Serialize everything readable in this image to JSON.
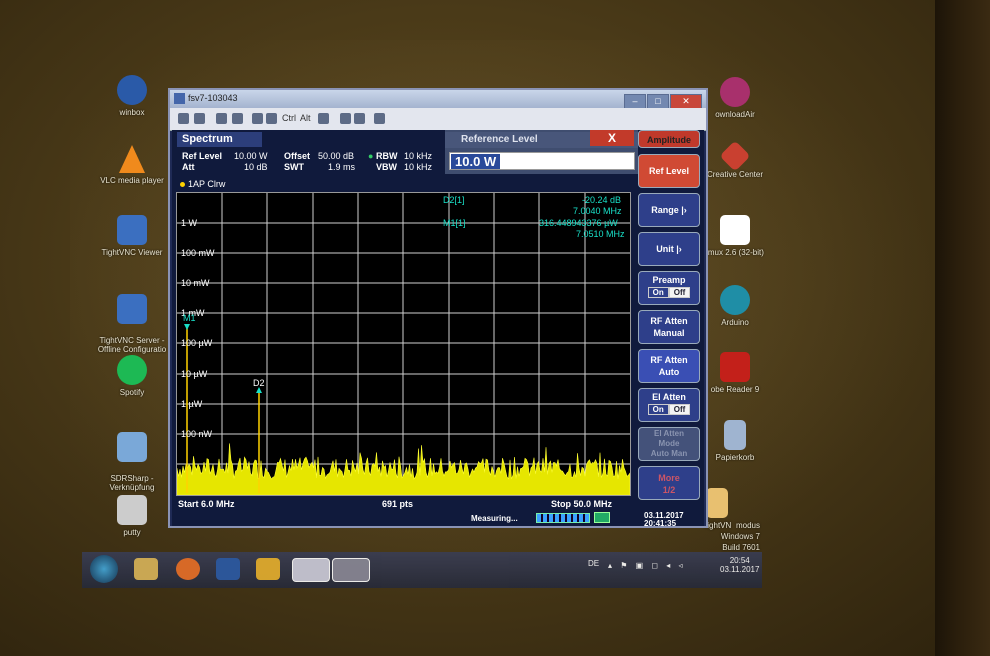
{
  "desktop": {
    "left_icons": [
      {
        "label": "winbox",
        "icon": "winbox-icon",
        "color": "#2a5aa8"
      },
      {
        "label": "VLC media player",
        "icon": "vlc-icon",
        "color": "#f08a1c"
      },
      {
        "label": "TightVNC Viewer",
        "icon": "tightvnc-viewer-icon",
        "color": "#3b6fc0"
      },
      {
        "label": "TightVNC Server -\nOffline Configuratio",
        "icon": "tightvnc-server-icon",
        "color": "#3b6fc0"
      },
      {
        "label": "Spotify",
        "icon": "spotify-icon",
        "color": "#1db954"
      },
      {
        "label": "SDRSharp -\nVerknüpfung",
        "icon": "sdrsharp-icon",
        "color": "#7aa8d8"
      },
      {
        "label": "putty",
        "icon": "putty-icon",
        "color": "#cccccc"
      }
    ],
    "right_icons": [
      {
        "label": "ownloadAir",
        "icon": "downloadair-icon",
        "color": "#a8306c"
      },
      {
        "label": "Creative Center",
        "icon": "creative-center-icon",
        "color": "#c94030"
      },
      {
        "label": "imux 2.6 (32-bit)",
        "icon": "linux-icon",
        "color": "#ffffff"
      },
      {
        "label": "Arduino",
        "icon": "arduino-icon",
        "color": "#1f8ea6"
      },
      {
        "label": "obe Reader 9",
        "icon": "adobe-reader-icon",
        "color": "#c3201a"
      },
      {
        "label": "Papierkorb",
        "icon": "recycle-bin-icon",
        "color": "#9fb4d0"
      },
      {
        "label": "TightVN",
        "icon": "folder-icon",
        "color": "#e8c070"
      }
    ],
    "watermark": {
      "line1": "modus",
      "line2": "Windows 7",
      "line3": "Build 7601"
    }
  },
  "window": {
    "title": "fsv7-103043",
    "toolbar_text_1": "Ctrl",
    "toolbar_text_2": "Alt",
    "controls": {
      "minimize": "–",
      "maximize": "□",
      "close": "✕"
    }
  },
  "spectrum": {
    "tab": "Spectrum",
    "ref_level_label": "Ref Level",
    "ref_level_value": "10.00 W",
    "offset_label": "Offset",
    "offset_value": "50.00 dB",
    "rbw_label": "RBW",
    "rbw_value": "10 kHz",
    "att_label": "Att",
    "att_value": "10 dB",
    "swt_label": "SWT",
    "swt_value": "1.9 ms",
    "vbw_label": "VBW",
    "vbw_value": "10 kHz",
    "trace_label": "1AP Clrw",
    "ref_level_dialog": {
      "title": "Reference Level",
      "close_label": "X",
      "input_value": "10.0 W"
    },
    "y_labels": [
      "1 W",
      "100 mW",
      "10 mW",
      "1 mW",
      "100 µW",
      "10 µW",
      "1 µW",
      "100 nW"
    ],
    "markers": {
      "d2_label": "D2[1]",
      "d2_level": "-20.24 dB",
      "d2_freq": "7.0040 MHz",
      "m1_label": "M1[1]",
      "m1_level": "316.448943376 µW",
      "m1_freq": "7.0510 MHz",
      "m1_tag": "M1",
      "d2_tag": "D2"
    },
    "footer": {
      "start": "Start 6.0 MHz",
      "points": "691 pts",
      "stop": "Stop 50.0 MHz"
    },
    "status": {
      "measuring": "Measuring...",
      "date": "03.11.2017",
      "time": "20:41:35"
    }
  },
  "softkeys": {
    "header": "Amplitude",
    "ref_level": "Ref Level",
    "range": "Range",
    "unit": "Unit",
    "preamp": "Preamp",
    "preamp_on": "On",
    "preamp_off": "Off",
    "rf_atten_manual_1": "RF Atten",
    "rf_atten_manual_2": "Manual",
    "rf_atten_auto_1": "RF Atten",
    "rf_atten_auto_2": "Auto",
    "el_atten": "El Atten",
    "el_atten_on": "On",
    "el_atten_off": "Off",
    "el_atten_mode_1": "El Atten",
    "el_atten_mode_2": "Mode",
    "el_atten_mode_3": "Auto  Man",
    "more_1": "More",
    "more_2": "1/2"
  },
  "taskbar": {
    "lang": "DE",
    "time": "20:54",
    "date": "03.11.2017"
  }
}
